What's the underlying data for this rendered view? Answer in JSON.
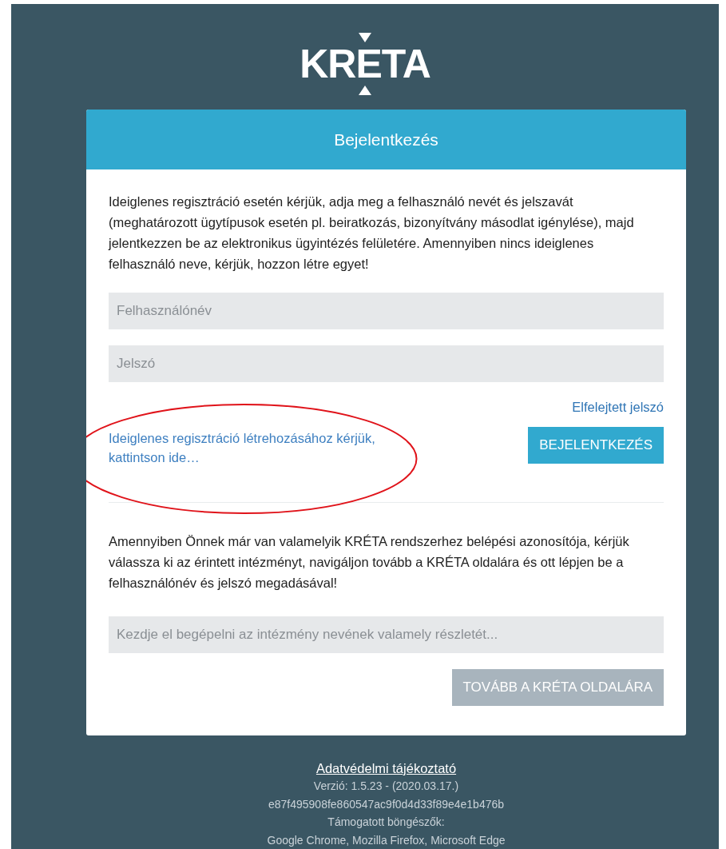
{
  "logo": {
    "text": "KRETA"
  },
  "login_card": {
    "title": "Bejelentkezés",
    "intro": "Ideiglenes regisztráció esetén kérjük, adja meg a felhasználó nevét és jelszavát (meghatározott ügytípusok esetén pl. beiratkozás, bizonyítvány másodlat igénylése), majd jelentkezzen be az elektronikus ügyintézés felületére. Amennyiben nincs ideiglenes felhasználó neve, kérjük, hozzon létre egyet!",
    "username": {
      "placeholder": "Felhasználónév"
    },
    "password": {
      "placeholder": "Jelszó"
    },
    "forgot_link": "Elfelejtett jelszó",
    "register_link": "Ideiglenes regisztráció létrehozásához kérjük, kattintson ide…",
    "login_button": {
      "label": "BEJELENTKEZÉS",
      "disabled": false
    },
    "existing_text": "Amennyiben Önnek már van valamelyik KRÉTA rendszerhez belépési azonosítója, kérjük válassza ki az érintett intézményt, navigáljon tovább a KRÉTA oldalára és ott lépjen be a felhasználónév és jelszó megadásával!",
    "institution": {
      "placeholder": "Kezdje el begépelni az intézmény nevének valamely részletét..."
    },
    "continue_button": {
      "label": "TOVÁBB A KRÉTA OLDALÁRA",
      "disabled": true
    }
  },
  "footer": {
    "privacy_link": "Adatvédelmi tájékoztató",
    "lines": [
      "Verzió: 1.5.23 - (2020.03.17.)",
      "e87f495908fe860547ac9f0d4d33f89e4e1b476b",
      "Támogatott böngészők:",
      "Google Chrome, Mozilla Firefox, Microsoft Edge"
    ]
  }
}
